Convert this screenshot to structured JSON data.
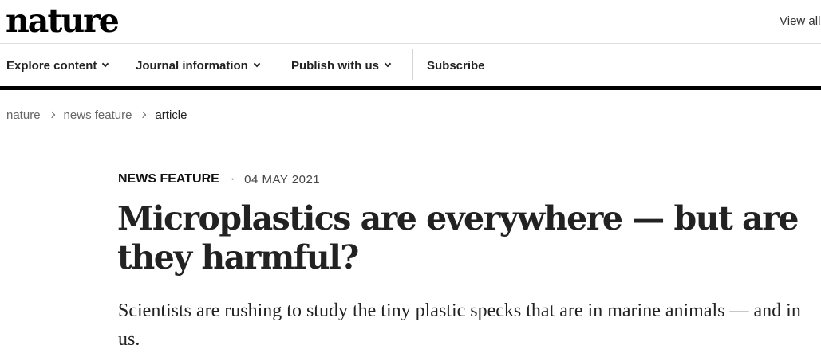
{
  "header": {
    "logo": "nature",
    "view_all": "View all"
  },
  "nav": {
    "items": [
      {
        "label": "Explore content"
      },
      {
        "label": "Journal information"
      },
      {
        "label": "Publish with us"
      }
    ],
    "subscribe": "Subscribe"
  },
  "breadcrumb": [
    {
      "label": "nature"
    },
    {
      "label": "news feature"
    },
    {
      "label": "article"
    }
  ],
  "article": {
    "type": "NEWS FEATURE",
    "separator": "·",
    "date": "04 MAY 2021",
    "title": "Microplastics are everywhere — but are they harmful?",
    "standfirst": "Scientists are rushing to study the tiny plastic specks that are in marine animals — and in us."
  }
}
